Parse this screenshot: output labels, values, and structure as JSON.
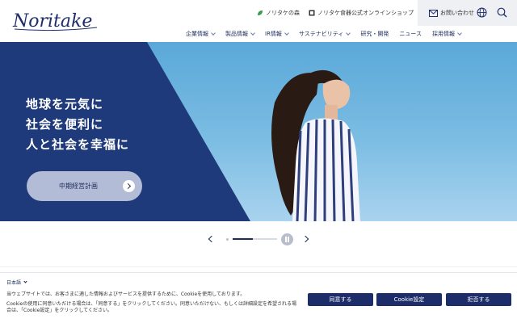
{
  "header": {
    "logo_text": "Noritake",
    "utility": {
      "forest_link": "ノリタケの森",
      "shop_link": "ノリタケ食器公式オンラインショップ",
      "contact_link": "お問い合わせ"
    },
    "nav": [
      {
        "label": "企業情報",
        "has_dropdown": true
      },
      {
        "label": "製品情報",
        "has_dropdown": true
      },
      {
        "label": "IR情報",
        "has_dropdown": true
      },
      {
        "label": "サステナビリティ",
        "has_dropdown": true
      },
      {
        "label": "研究・開発",
        "has_dropdown": false
      },
      {
        "label": "ニュース",
        "has_dropdown": false
      },
      {
        "label": "採用情報",
        "has_dropdown": true
      }
    ]
  },
  "hero": {
    "lines": [
      "地球を元気に",
      "社会を便利に",
      "人と社会を幸福に"
    ],
    "button_label": "中期経営計画"
  },
  "slider": {
    "progress": 0.45
  },
  "cookie": {
    "language": "日本語",
    "text_line1": "当ウェブサイトでは、お客さまに適した情報およびサービスを提供するために、Cookieを使用しております。",
    "text_line2": "Cookieの使用に同意いただける場合は、「同意する」をクリックしてください。同意いただけない、もしくは詳細設定を希望される場",
    "text_line3": "合は、「Cookie設定」をクリックしてください。",
    "agree_label": "同意する",
    "settings_label": "Cookie設定",
    "reject_label": "拒否する"
  },
  "colors": {
    "brand_navy": "#1d2d6a",
    "hero_panel": "#1f3a7a",
    "sky": "#6fb6e0"
  }
}
